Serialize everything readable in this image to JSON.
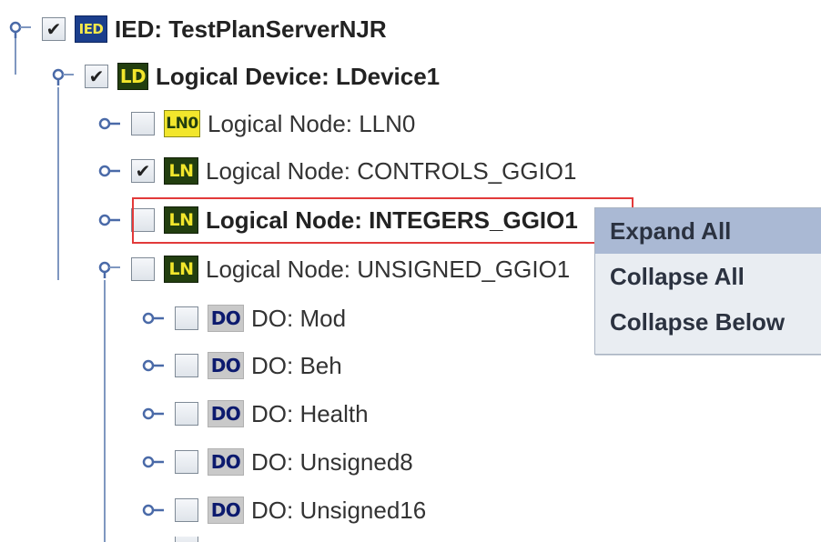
{
  "tree": {
    "ied": {
      "badge": "IED",
      "label": "IED: TestPlanServerNJR",
      "checked": "✔"
    },
    "ld": {
      "badge": "LD",
      "label": "Logical Device: LDevice1",
      "checked": "✔"
    },
    "nodes": [
      {
        "badge": "LN0",
        "label": "Logical Node: LLN0",
        "checked": ""
      },
      {
        "badge": "LN",
        "label": "Logical Node: CONTROLS_GGIO1",
        "checked": "✔"
      },
      {
        "badge": "LN",
        "label": "Logical Node: INTEGERS_GGIO1",
        "checked": ""
      },
      {
        "badge": "LN",
        "label": "Logical Node: UNSIGNED_GGIO1",
        "checked": ""
      }
    ],
    "data_objects": [
      {
        "badge": "DO",
        "label": "DO: Mod"
      },
      {
        "badge": "DO",
        "label": "DO: Beh"
      },
      {
        "badge": "DO",
        "label": "DO: Health"
      },
      {
        "badge": "DO",
        "label": "DO: Unsigned8"
      },
      {
        "badge": "DO",
        "label": "DO: Unsigned16"
      }
    ]
  },
  "context_menu": {
    "items": [
      "Expand All",
      "Collapse All",
      "Collapse Below"
    ],
    "highlighted": "Expand All"
  },
  "colors": {
    "tree_line": "#7f97c0",
    "selection_border": "#e23a3a",
    "menu_bg": "#e9edf2",
    "menu_highlight": "#aab9d4",
    "ln_badge_bg": "#223e0f",
    "ln_badge_fg": "#f2e62c",
    "ied_badge_bg": "#1b3e8c",
    "do_badge_bg": "#c9c9c9"
  }
}
